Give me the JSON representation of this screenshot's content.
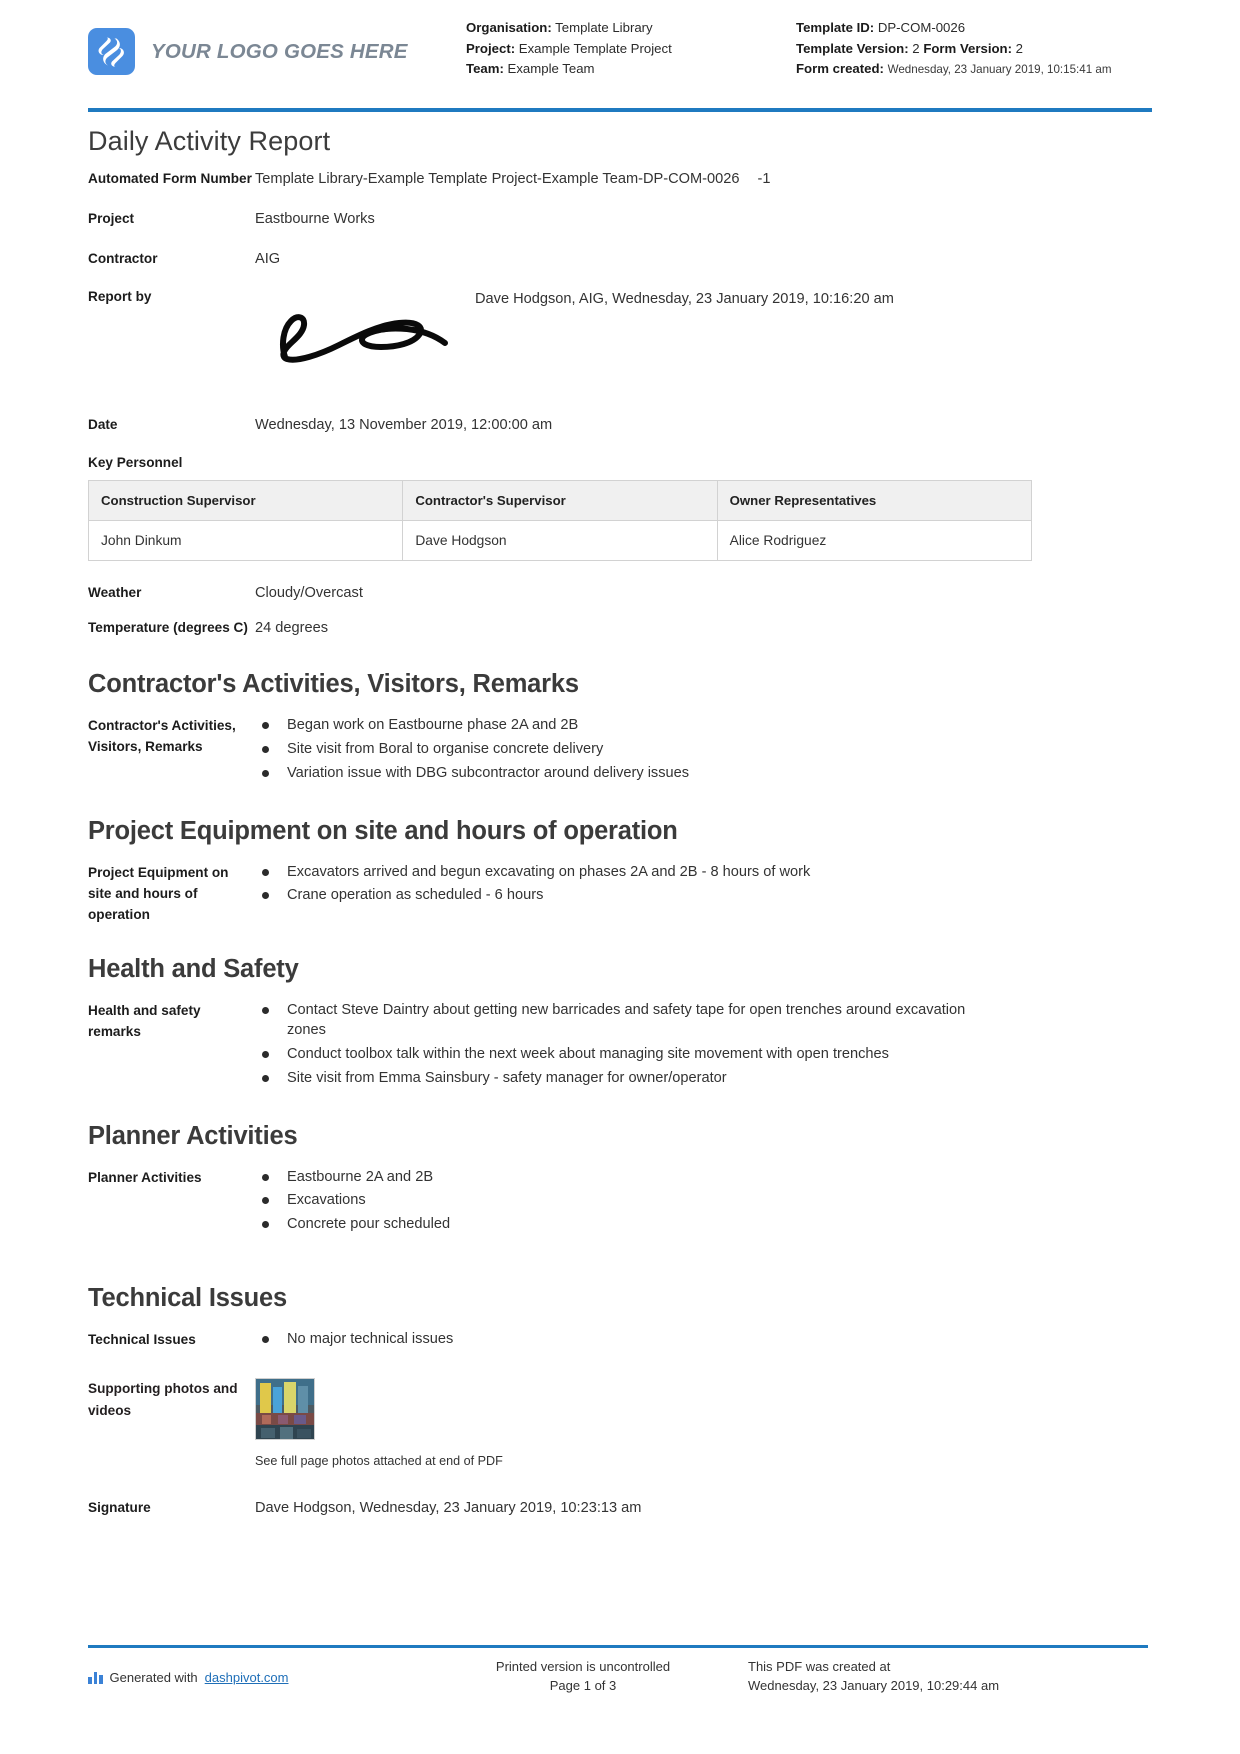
{
  "header": {
    "logo_text": "YOUR LOGO GOES HERE",
    "left_meta": [
      {
        "label": "Organisation:",
        "value": "Template Library"
      },
      {
        "label": "Project:",
        "value": "Example Template Project"
      },
      {
        "label": "Team:",
        "value": "Example Team"
      }
    ],
    "right_meta": {
      "template_id_label": "Template ID:",
      "template_id_value": "DP-COM-0026",
      "template_version_label": "Template Version:",
      "template_version_value": "2",
      "form_version_label": "Form Version:",
      "form_version_value": "2",
      "form_created_label": "Form created:",
      "form_created_value": "Wednesday, 23 January 2019, 10:15:41 am"
    }
  },
  "doc": {
    "title": "Daily Activity Report",
    "automated_form_number_label": "Automated Form Number",
    "automated_form_number_value": "Template Library-Example Template Project-Example Team-DP-COM-0026",
    "automated_form_number_suffix": "-1",
    "project_label": "Project",
    "project_value": "Eastbourne Works",
    "contractor_label": "Contractor",
    "contractor_value": "AIG",
    "report_by_label": "Report by",
    "report_by_value": "Dave Hodgson, AIG, Wednesday, 23 January 2019, 10:16:20 am",
    "date_label": "Date",
    "date_value": "Wednesday, 13 November 2019, 12:00:00 am",
    "weather_label": "Weather",
    "weather_value": "Cloudy/Overcast",
    "temperature_label": "Temperature (degrees C)",
    "temperature_value": "24 degrees"
  },
  "key_personnel": {
    "label": "Key Personnel",
    "columns": [
      "Construction Supervisor",
      "Contractor's Supervisor",
      "Owner Representatives"
    ],
    "rows": [
      [
        "John Dinkum",
        "Dave Hodgson",
        "Alice Rodriguez"
      ]
    ]
  },
  "sections": [
    {
      "heading": "Contractor's Activities, Visitors, Remarks",
      "field_label": "Contractor's Activities, Visitors, Remarks",
      "items": [
        "Began work on Eastbourne phase 2A and 2B",
        "Site visit from Boral to organise concrete delivery",
        "Variation issue with DBG subcontractor around delivery issues"
      ]
    },
    {
      "heading": "Project Equipment on site and hours of operation",
      "field_label": "Project Equipment on site and hours of operation",
      "items": [
        "Excavators arrived and begun excavating on phases 2A and 2B - 8 hours of work",
        "Crane operation as scheduled - 6 hours"
      ]
    },
    {
      "heading": "Health and Safety",
      "field_label": "Health and safety remarks",
      "items": [
        "Contact Steve Daintry about getting new barricades and safety tape for open trenches around excavation zones",
        "Conduct toolbox talk within the next week about managing site movement with open trenches",
        "Site visit from Emma Sainsbury - safety manager for owner/operator"
      ]
    },
    {
      "heading": "Planner Activities",
      "field_label": "Planner Activities",
      "items": [
        "Eastbourne 2A and 2B",
        "Excavations",
        "Concrete pour scheduled"
      ]
    },
    {
      "heading": "Technical Issues",
      "field_label": "Technical Issues",
      "items": [
        "No major technical issues"
      ]
    }
  ],
  "photos": {
    "label": "Supporting photos and videos",
    "caption": "See full page photos attached at end of PDF"
  },
  "signature": {
    "label": "Signature",
    "value": "Dave Hodgson, Wednesday, 23 January 2019, 10:23:13 am"
  },
  "footer": {
    "generated_prefix": "Generated with",
    "generated_link": "dashpivot.com",
    "uncontrolled": "Printed version is uncontrolled",
    "page": "Page 1 of 3",
    "created_label": "This PDF was created at",
    "created_value": "Wednesday, 23 January 2019, 10:29:44 am"
  },
  "colors": {
    "accent_blue": "#1f7ac0",
    "logo_blue": "#4a8ee0",
    "link_blue": "#1f6fb8"
  }
}
